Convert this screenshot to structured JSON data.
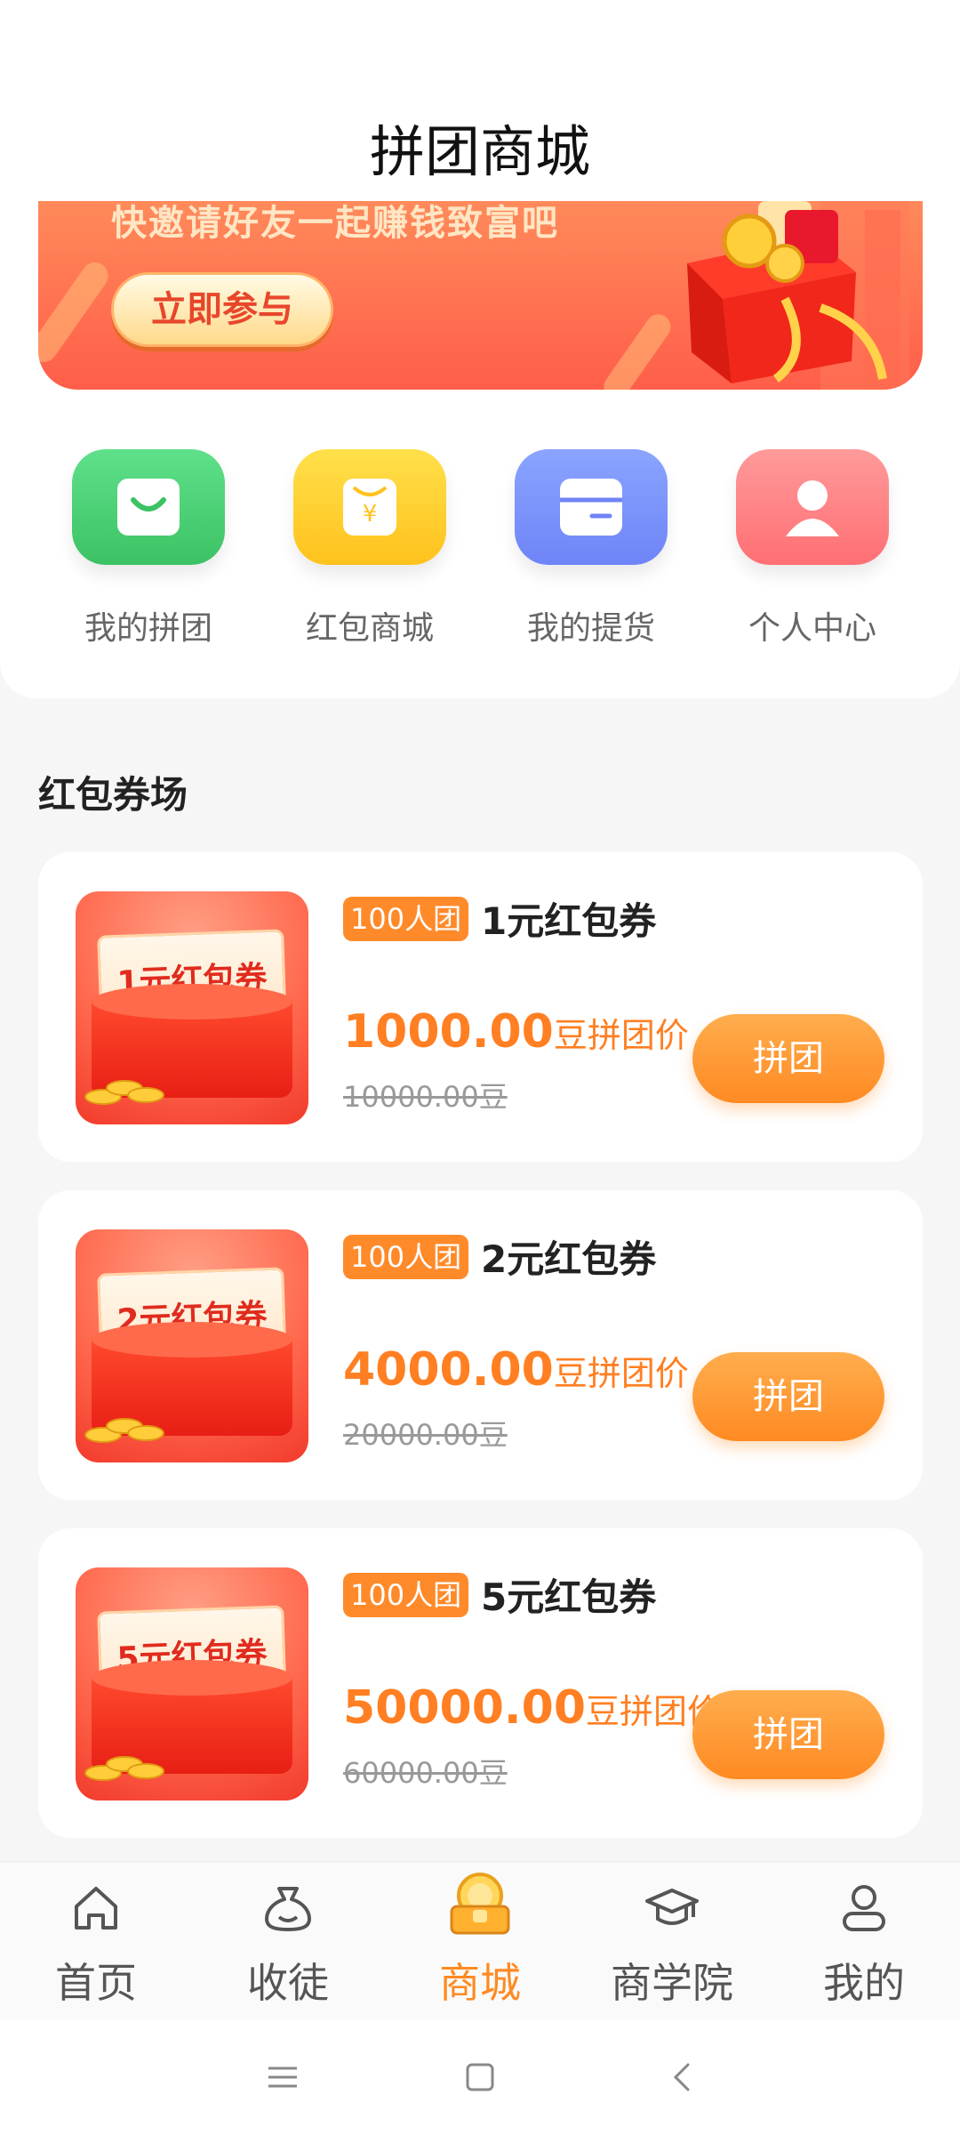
{
  "header": {
    "title": "拼团商城"
  },
  "banner": {
    "text": "快邀请好友一起赚钱致富吧",
    "button_label": "立即参与"
  },
  "quick_links": [
    {
      "label": "我的拼团",
      "icon": "bag-icon",
      "color": "#4ccf73"
    },
    {
      "label": "红包商城",
      "icon": "red-packet-icon",
      "color": "#ffd02d"
    },
    {
      "label": "我的提货",
      "icon": "box-icon",
      "color": "#7c93ff"
    },
    {
      "label": "个人中心",
      "icon": "person-icon",
      "color": "#ff7c7f"
    }
  ],
  "section": {
    "title": "红包券场"
  },
  "products": [
    {
      "image_text": "1元红包券",
      "badge": "100人团",
      "name": "1元红包券",
      "price": "1000.00",
      "price_suffix": "豆拼团价",
      "original_price": "10000.00豆",
      "button": "拼团"
    },
    {
      "image_text": "2元红包券",
      "badge": "100人团",
      "name": "2元红包券",
      "price": "4000.00",
      "price_suffix": "豆拼团价",
      "original_price": "20000.00豆",
      "button": "拼团"
    },
    {
      "image_text": "5元红包券",
      "badge": "100人团",
      "name": "5元红包券",
      "price": "50000.00",
      "price_suffix": "豆拼团价",
      "original_price": "60000.00豆",
      "button": "拼团"
    }
  ],
  "tabbar": {
    "items": [
      {
        "label": "首页",
        "icon": "home-icon"
      },
      {
        "label": "收徒",
        "icon": "money-bag-icon"
      },
      {
        "label": "商城",
        "icon": "treasure-chest-icon",
        "active": true
      },
      {
        "label": "商学院",
        "icon": "graduation-cap-icon"
      },
      {
        "label": "我的",
        "icon": "user-icon"
      }
    ]
  },
  "system_nav": {
    "menu": "menu-icon",
    "home": "home-square-icon",
    "back": "back-icon"
  },
  "colors": {
    "accent": "#ff8a22",
    "banner": "#ff5e4a"
  }
}
